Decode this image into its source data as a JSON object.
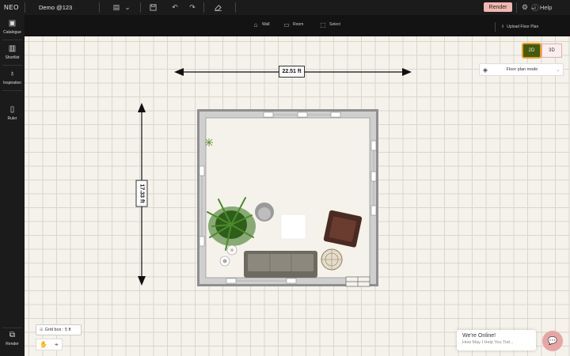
{
  "topbar": {
    "logo": "NEO",
    "project_name": "Demo @123",
    "render_label": "Render",
    "help_label": "Help"
  },
  "tools": {
    "wall_label": "Wall",
    "room_label": "Room",
    "select_label": "Select",
    "upload_label": "Upload Floor Plan"
  },
  "sidebar": {
    "items": [
      {
        "label": "Catalogue",
        "icon": "cube-icon"
      },
      {
        "label": "Shortlist",
        "icon": "bookmark-icon"
      },
      {
        "label": "Inspiration",
        "icon": "bulb-icon"
      },
      {
        "label": "Ruler",
        "icon": "ruler-icon"
      }
    ],
    "render_label": "Render"
  },
  "view_toggle": {
    "label_2d": "2D",
    "label_3d": "3D",
    "active": "2D"
  },
  "floor_plan_mode": {
    "label": "Floor plan mode"
  },
  "dimensions": {
    "width": "22.51 ft",
    "height": "17.33 ft"
  },
  "grid_box": {
    "label": "Grid box : 5 ft"
  },
  "chat": {
    "title": "We're Online!",
    "subtitle": "How May I Help You Tod..."
  },
  "colors": {
    "accent": "#f0b8b0",
    "toggle_active": "#455a0e",
    "toggle_border": "#e8a020"
  }
}
